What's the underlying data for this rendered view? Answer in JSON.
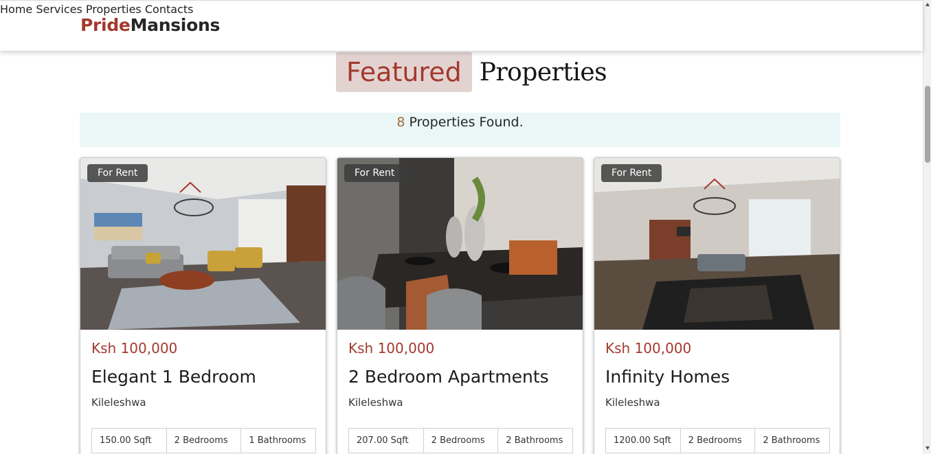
{
  "brand": {
    "part1": "Pride",
    "part2": "Mansions",
    "accent": "#a3392c"
  },
  "nav": [
    "Home",
    "Services",
    "Properties",
    "Contacts"
  ],
  "heading": {
    "highlight": "Featured",
    "rest": "Properties"
  },
  "found": {
    "count": "8",
    "text": " Properties Found."
  },
  "cards": [
    {
      "badge": "For Rent",
      "price": "Ksh 100,000",
      "title": "Elegant 1 Bedroom",
      "location": "Kileleshwa",
      "specs": [
        "150.00 Sqft",
        "2 Bedrooms",
        "1 Bathrooms"
      ],
      "image": "living-room-photo"
    },
    {
      "badge": "For Rent",
      "price": "Ksh 100,000",
      "title": "2 Bedroom Apartments",
      "location": "Kileleshwa",
      "specs": [
        "207.00 Sqft",
        "2 Bedrooms",
        "2 Bathrooms"
      ],
      "image": "dining-room-photo"
    },
    {
      "badge": "For Rent",
      "price": "Ksh 100,000",
      "title": "Infinity Homes",
      "location": "Kileleshwa",
      "specs": [
        "1200.00 Sqft",
        "2 Bedrooms",
        "2 Bathrooms"
      ],
      "image": "open-plan-kitchen-photo"
    }
  ]
}
